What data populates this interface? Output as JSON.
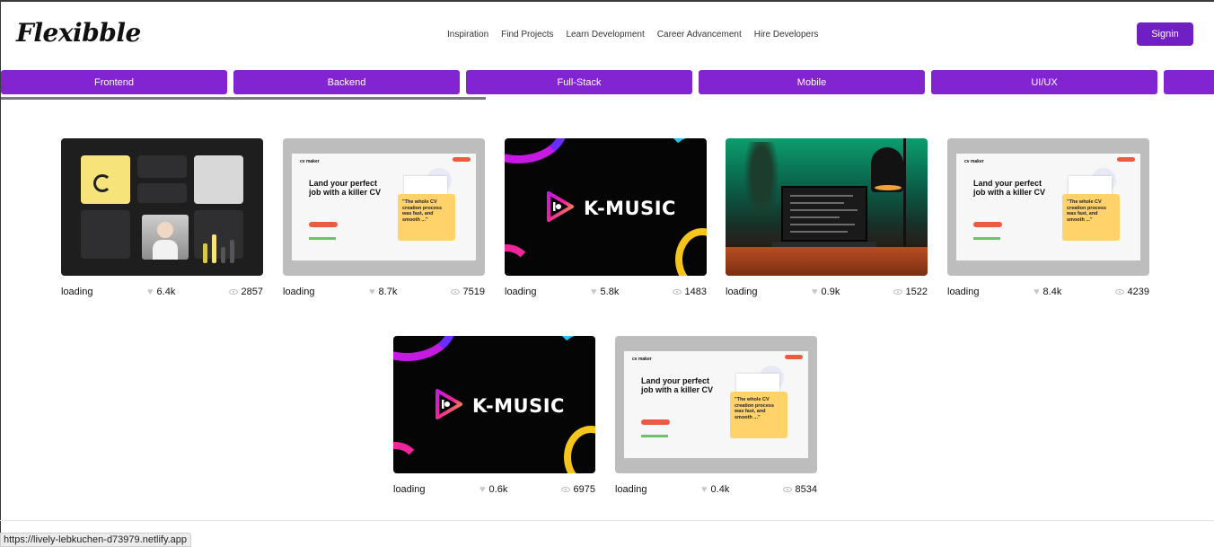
{
  "header": {
    "logo": "Flexibble",
    "nav": [
      "Inspiration",
      "Find Projects",
      "Learn Development",
      "Career Advancement",
      "Hire Developers"
    ],
    "signin_label": "Signin"
  },
  "categories": [
    "Frontend",
    "Backend",
    "Full-Stack",
    "Mobile",
    "UI/UX",
    ""
  ],
  "cv_thumb": {
    "brand": "cv maker",
    "headline": "Land your perfect job with a killer CV",
    "quote": "\"The whole CV creation process was fast, and smooth ...\""
  },
  "km_thumb": {
    "word": "K-MUSIC"
  },
  "projects": [
    {
      "thumb": "dashboard",
      "author": "loading",
      "likes": "6.4k",
      "views": "2857"
    },
    {
      "thumb": "cv",
      "author": "loading",
      "likes": "8.7k",
      "views": "7519"
    },
    {
      "thumb": "kmusic",
      "author": "loading",
      "likes": "5.8k",
      "views": "1483"
    },
    {
      "thumb": "laptop",
      "author": "loading",
      "likes": "0.9k",
      "views": "1522"
    },
    {
      "thumb": "cv",
      "author": "loading",
      "likes": "8.4k",
      "views": "4239"
    },
    {
      "thumb": "kmusic",
      "author": "loading",
      "likes": "0.6k",
      "views": "6975"
    },
    {
      "thumb": "cv",
      "author": "loading",
      "likes": "0.4k",
      "views": "8534"
    }
  ],
  "status_url": "https://lively-lebkuchen-d73979.netlify.app",
  "colors": {
    "accent": "#8224d1",
    "signin": "#6f1fc4"
  }
}
